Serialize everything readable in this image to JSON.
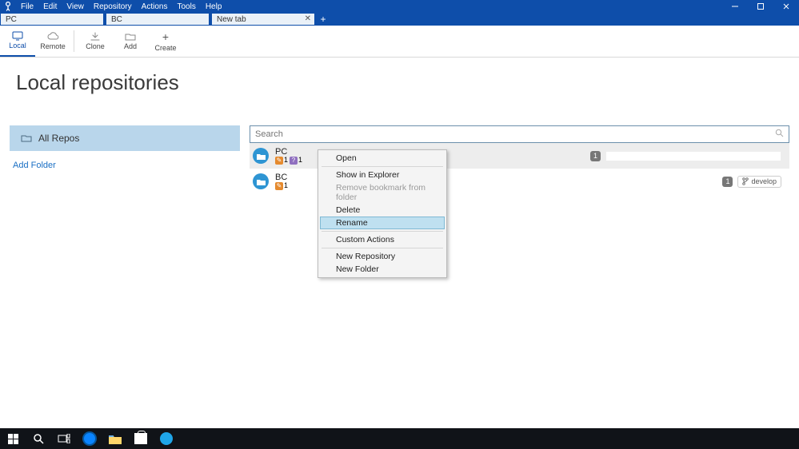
{
  "menu": {
    "file": "File",
    "edit": "Edit",
    "view": "View",
    "repository": "Repository",
    "actions": "Actions",
    "tools": "Tools",
    "help": "Help"
  },
  "tabs": {
    "t0": "PC",
    "t1": "BC",
    "t2": "New tab"
  },
  "toolbar": {
    "local": "Local",
    "remote": "Remote",
    "clone": "Clone",
    "add": "Add",
    "create": "Create"
  },
  "page": {
    "heading": "Local repositories"
  },
  "sidebar": {
    "all_repos": "All Repos",
    "add_folder": "Add Folder"
  },
  "search": {
    "placeholder": "Search"
  },
  "repos": [
    {
      "name": "PC",
      "pending": "1",
      "unknown": "1",
      "count": "1"
    },
    {
      "name": "BC",
      "pending": "1",
      "count": "1",
      "branch": "develop"
    }
  ],
  "ctx": {
    "open": "Open",
    "explorer": "Show in Explorer",
    "remove": "Remove bookmark from folder",
    "delete": "Delete",
    "rename": "Rename",
    "custom": "Custom Actions",
    "newrepo": "New Repository",
    "newfolder": "New Folder"
  }
}
